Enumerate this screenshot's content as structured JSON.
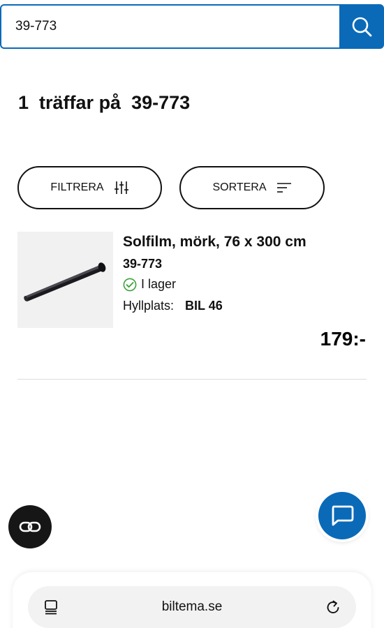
{
  "search": {
    "query": "39-773"
  },
  "results": {
    "count": "1",
    "label": "träffar på",
    "term": "39-773"
  },
  "controls": {
    "filter_label": "FILTRERA",
    "sort_label": "SORTERA"
  },
  "product": {
    "title": "Solfilm, mörk, 76 x 300 cm",
    "sku": "39-773",
    "stock": "I lager",
    "shelf_label": "Hyllplats:",
    "shelf_value": "BIL 46",
    "price": "179:-"
  },
  "browser": {
    "url": "biltema.se"
  },
  "colors": {
    "brand_blue": "#0a6ab8",
    "stock_green": "#3aa23a",
    "dark": "#161616"
  },
  "icons": {
    "search": "search-icon",
    "filter": "sliders-icon",
    "sort": "sort-lines-icon",
    "stock": "check-circle-icon",
    "link": "link-icon",
    "chat": "chat-bubble-icon",
    "tabs": "tabs-icon",
    "reload": "reload-icon"
  }
}
